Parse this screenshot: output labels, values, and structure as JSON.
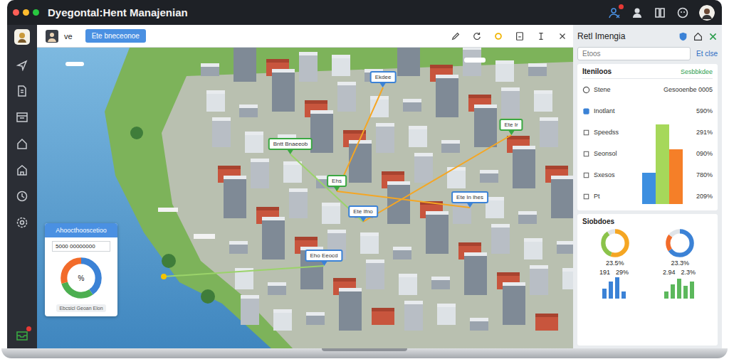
{
  "window": {
    "title": "Dyegontal:Hent Manajenian",
    "dots": [
      {
        "color": "#ff5f57"
      },
      {
        "color": "#febc2e"
      },
      {
        "color": "#28c840"
      }
    ]
  },
  "toolbar": {
    "user": "ve",
    "button": "Ete bneceonoe"
  },
  "map": {
    "pins": [
      {
        "label": "Bntt Bnaeeob",
        "color": "#3aa842"
      },
      {
        "label": "Ekdee",
        "color": "#3b82d6"
      },
      {
        "label": "Ehs",
        "color": "#3aa842"
      },
      {
        "label": "Ete Ir",
        "color": "#3aa842"
      },
      {
        "label": "Ete In lhes",
        "color": "#3b82d6"
      },
      {
        "label": "Ete Ifno",
        "color": "#3b82d6"
      },
      {
        "label": "Eho Eeocd",
        "color": "#3b82d6"
      }
    ],
    "card": {
      "title": "Ahoocthooscetioo",
      "field": "5000 00000000",
      "center": "%",
      "footer": "Ebcsicl Geoan Elon",
      "segments": [
        {
          "value": 40,
          "color": "#3b82d6"
        },
        {
          "value": 30,
          "color": "#4caf50"
        },
        {
          "value": 30,
          "color": "#f26b2a"
        }
      ]
    }
  },
  "panel": {
    "title": "Retl Imengia",
    "search": {
      "placeholder": "Etoos"
    },
    "link": "Et clse",
    "stats": {
      "title": "Iteniloos",
      "action": "Sesbbkdee",
      "rows": [
        {
          "label": "Stene",
          "value": "Gesooenbe 0005"
        },
        {
          "label": "Inotlant",
          "value": "590%"
        },
        {
          "label": "Speedss",
          "value": "291%"
        },
        {
          "label": "Seonsol",
          "value": "090%"
        },
        {
          "label": "Sxesos",
          "value": "780%"
        },
        {
          "label": "Pt",
          "value": "209%"
        }
      ],
      "chart": {
        "bars": [
          {
            "value": 38,
            "color": "#3d8fe0"
          },
          {
            "value": 96,
            "color": "#a6d85a"
          },
          {
            "value": 66,
            "color": "#f57f28"
          }
        ]
      }
    },
    "summary": {
      "title": "Siobdoes",
      "donuts": [
        {
          "label": "23.5%",
          "segments": [
            {
              "value": 55,
              "color": "#f5a623"
            },
            {
              "value": 35,
              "color": "#8bc34a"
            },
            {
              "value": 10,
              "color": "#e0e4e8"
            }
          ]
        },
        {
          "label": "23.3%",
          "segments": [
            {
              "value": 65,
              "color": "#3b82d6"
            },
            {
              "value": 20,
              "color": "#f26b2a"
            },
            {
              "value": 15,
              "color": "#e0e4e8"
            }
          ]
        }
      ],
      "groups": [
        {
          "labels": [
            "191",
            "29%"
          ],
          "values": [
            14,
            24,
            30,
            10
          ],
          "color": "#3b82d6"
        },
        {
          "labels": [
            "2.94",
            "2.3%"
          ],
          "values": [
            10,
            20,
            28,
            18,
            24
          ],
          "color": "#5cb85c"
        }
      ]
    }
  }
}
